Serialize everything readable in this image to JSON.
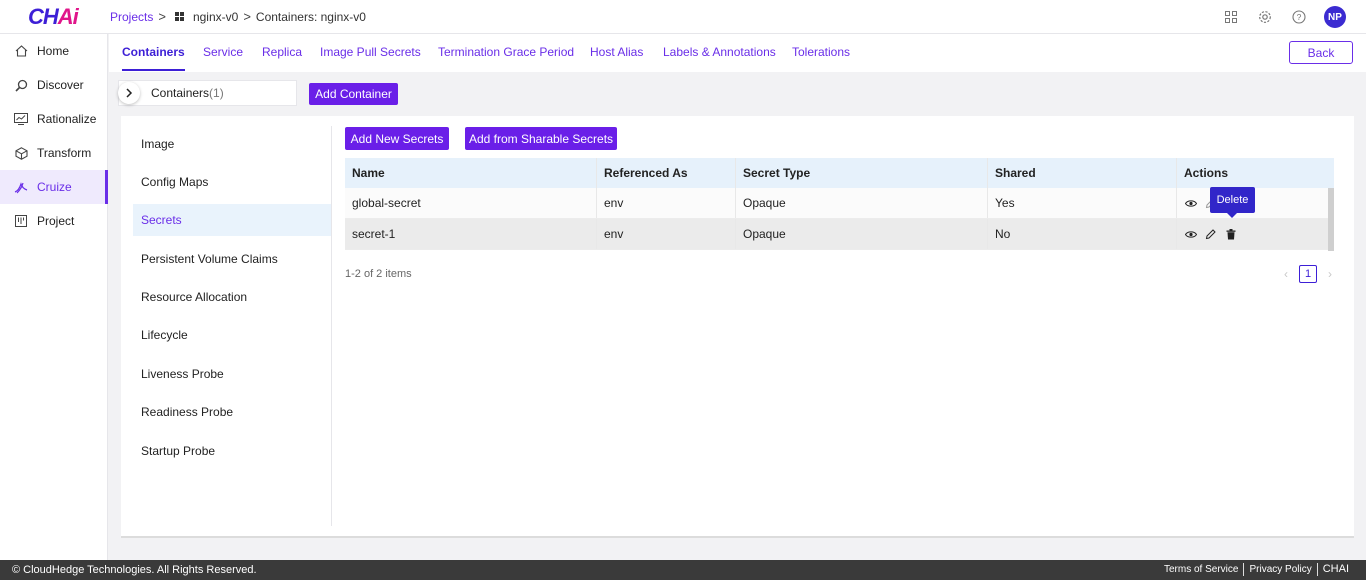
{
  "app": {
    "logo_main": "CH",
    "logo_accent": "Ai"
  },
  "breadcrumb": {
    "projects": "Projects",
    "sep": ">",
    "project": "nginx-v0",
    "current": "Containers: nginx-v0"
  },
  "user": {
    "initials": "NP"
  },
  "sidebar": {
    "items": [
      {
        "label": "Home",
        "icon": "home-icon"
      },
      {
        "label": "Discover",
        "icon": "discover-icon"
      },
      {
        "label": "Rationalize",
        "icon": "rationalize-icon"
      },
      {
        "label": "Transform",
        "icon": "transform-icon"
      },
      {
        "label": "Cruize",
        "icon": "cruize-icon",
        "active": true
      },
      {
        "label": "Project",
        "icon": "project-icon"
      }
    ]
  },
  "tabs": [
    {
      "label": "Containers",
      "active": true
    },
    {
      "label": "Service"
    },
    {
      "label": "Replica"
    },
    {
      "label": "Image Pull Secrets"
    },
    {
      "label": "Termination Grace Period"
    },
    {
      "label": "Host Alias"
    },
    {
      "label": "Labels & Annotations"
    },
    {
      "label": "Tolerations"
    }
  ],
  "back_label": "Back",
  "container_select": {
    "label": "Containers",
    "count": "(1)"
  },
  "add_container_label": "Add Container",
  "left_menu": [
    {
      "label": "Image"
    },
    {
      "label": "Config Maps"
    },
    {
      "label": "Secrets",
      "active": true
    },
    {
      "label": "Persistent Volume Claims"
    },
    {
      "label": "Resource Allocation"
    },
    {
      "label": "Lifecycle"
    },
    {
      "label": "Liveness Probe"
    },
    {
      "label": "Readiness Probe"
    },
    {
      "label": "Startup Probe"
    }
  ],
  "secrets": {
    "add_new_label": "Add New Secrets",
    "add_sharable_label": "Add from Sharable Secrets",
    "columns": [
      "Name",
      "Referenced As",
      "Secret Type",
      "Shared",
      "Actions"
    ],
    "rows": [
      {
        "name": "global-secret",
        "referenced_as": "env",
        "secret_type": "Opaque",
        "shared": "Yes"
      },
      {
        "name": "secret-1",
        "referenced_as": "env",
        "secret_type": "Opaque",
        "shared": "No"
      }
    ],
    "tooltip": "Delete",
    "items_info": "1-2 of 2 items",
    "current_page": "1"
  },
  "footer": {
    "copyright": "© CloudHedge Technologies. All Rights Reserved.",
    "terms": "Terms of Service",
    "privacy": "Privacy Policy",
    "brand": "CHAI"
  }
}
